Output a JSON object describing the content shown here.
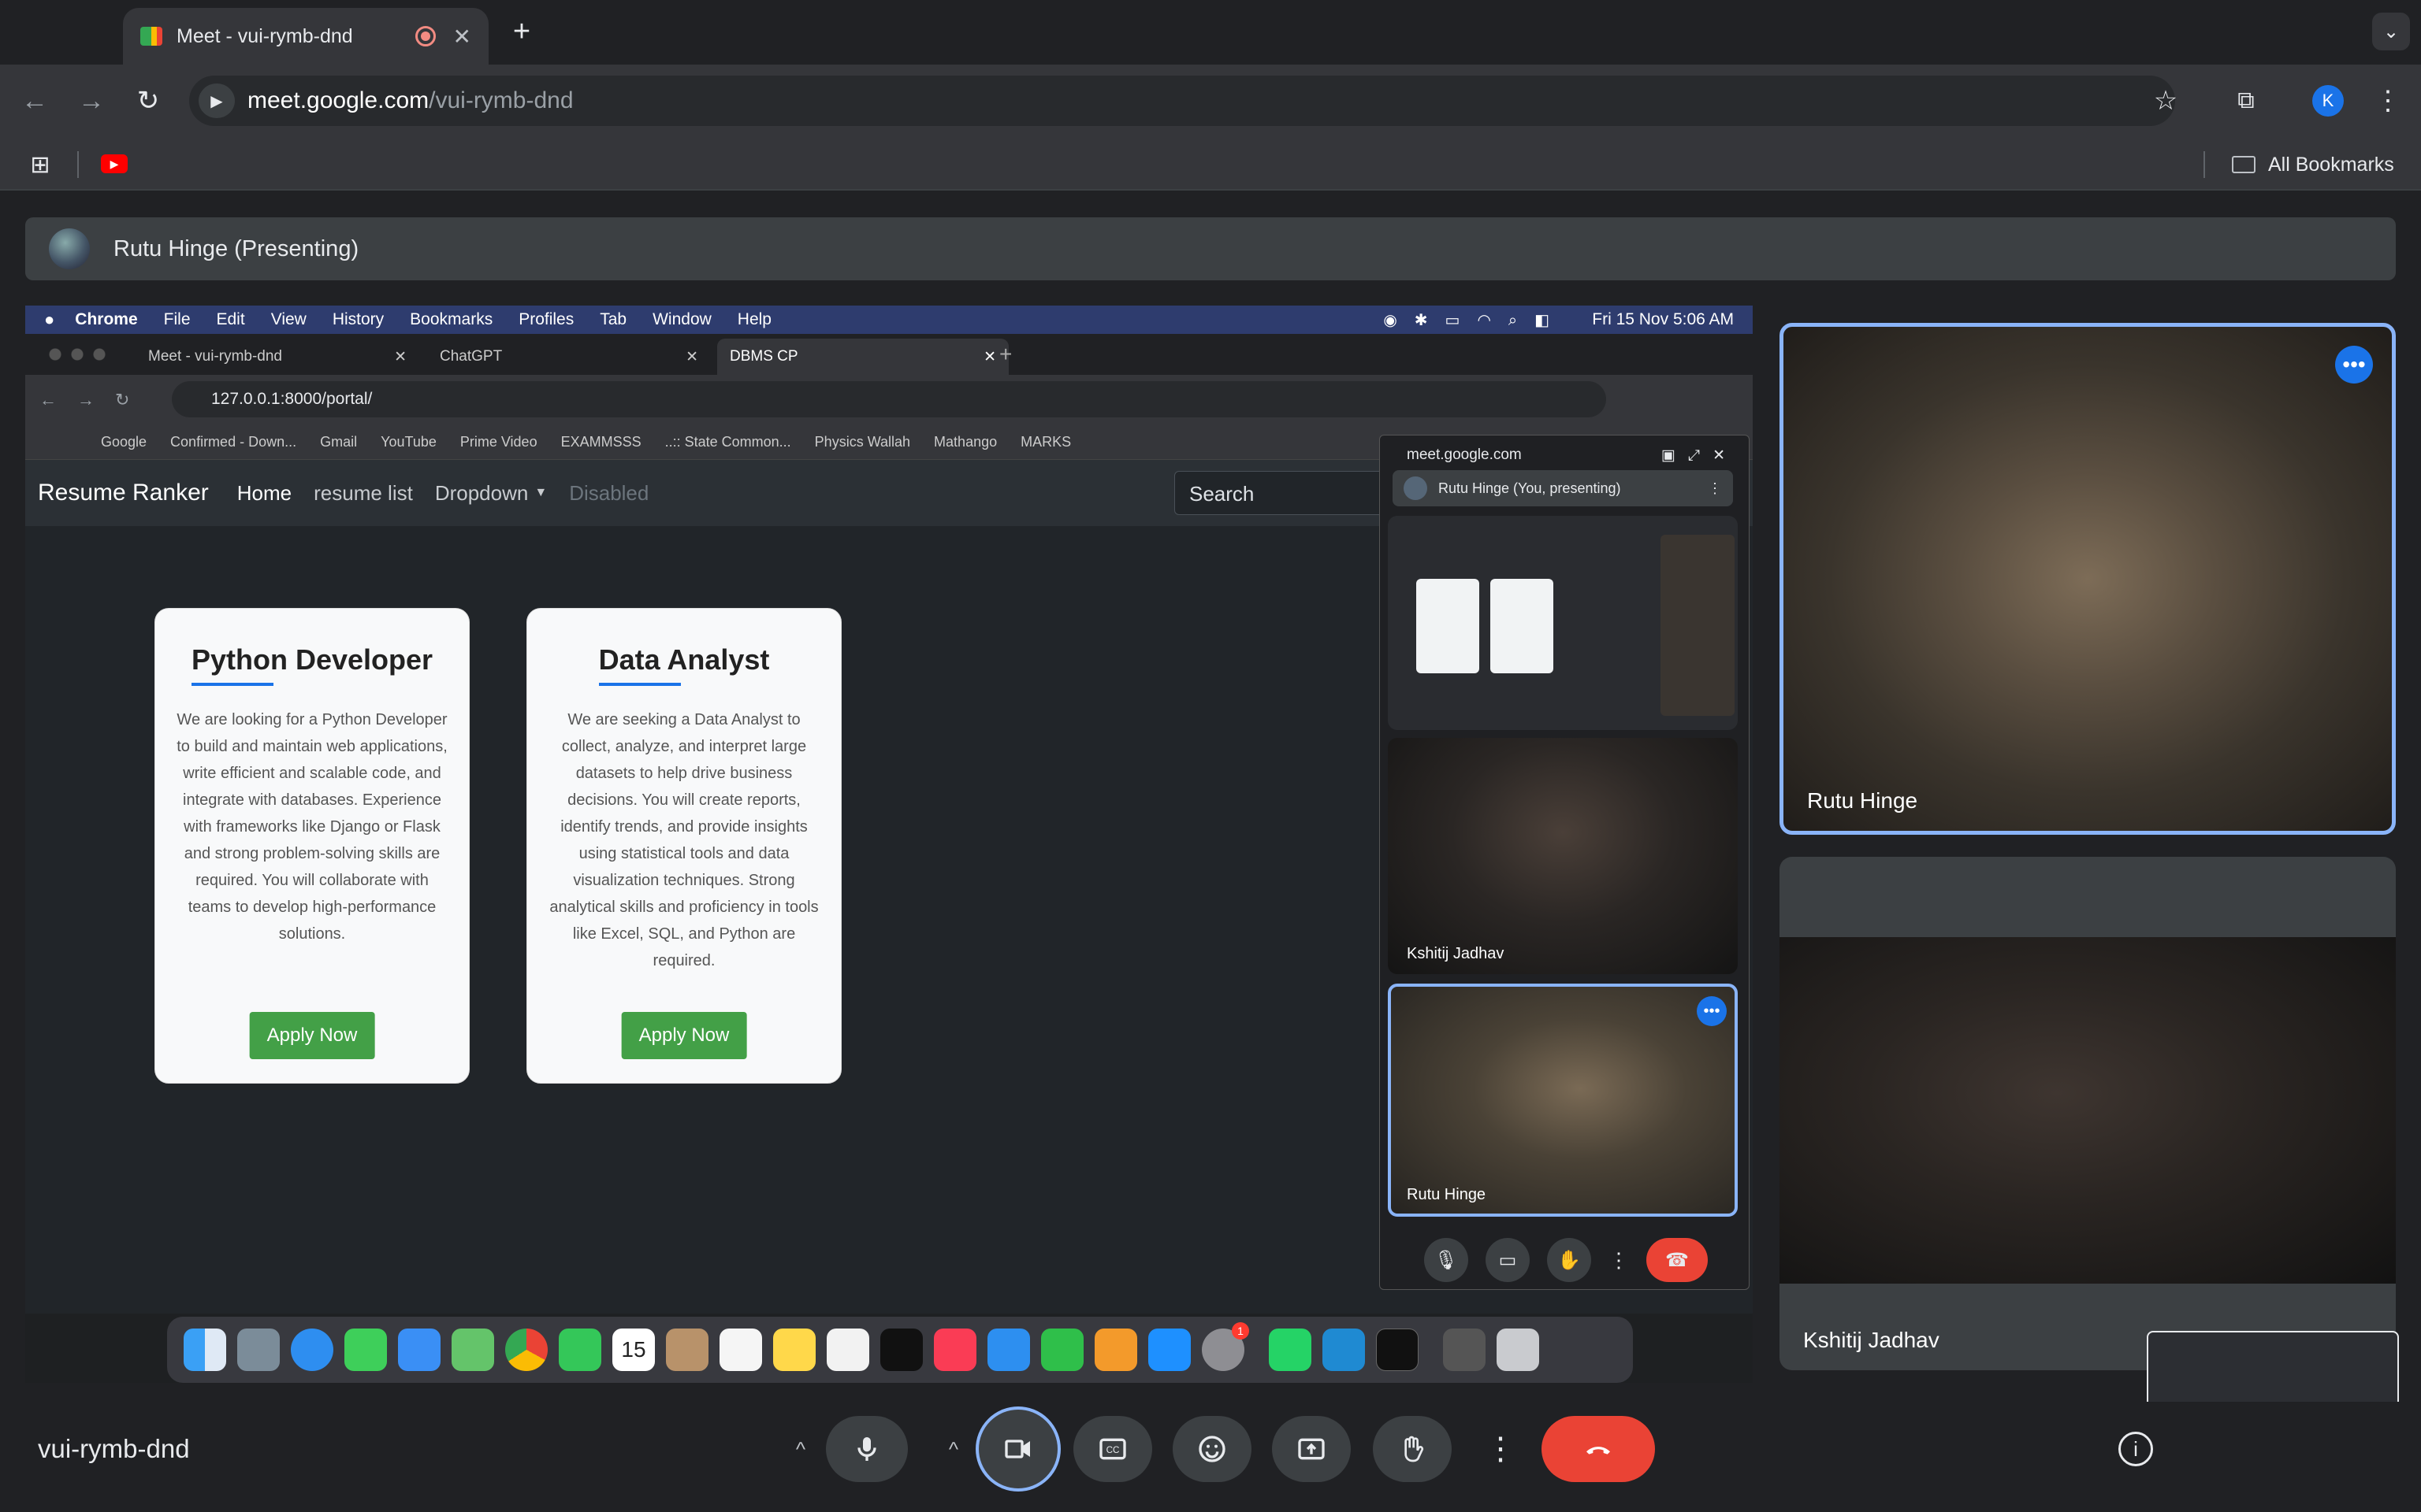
{
  "browser": {
    "tab_title": "Meet - vui-rymb-dnd",
    "url_domain": "meet.google.com",
    "url_path": "/vui-rymb-dnd",
    "profile_initial": "K",
    "all_bookmarks": "All Bookmarks"
  },
  "meet": {
    "presenter_label": "Rutu Hinge (Presenting)",
    "meeting_code": "vui-rymb-dnd",
    "participants": [
      "Rutu Hinge",
      "Kshitij Jadhav"
    ]
  },
  "shared_screen": {
    "mac_menu": [
      "Chrome",
      "File",
      "Edit",
      "View",
      "History",
      "Bookmarks",
      "Profiles",
      "Tab",
      "Window",
      "Help"
    ],
    "clock": "Fri 15 Nov  5:06 AM",
    "tabs": [
      "Meet - vui-rymb-dnd",
      "ChatGPT",
      "DBMS CP"
    ],
    "url": "127.0.0.1:8000/portal/",
    "bookmarks": [
      "Google",
      "Confirmed - Down...",
      "Gmail",
      "YouTube",
      "Prime Video",
      "EXAMMSSS",
      "..:: State Common...",
      "Physics Wallah",
      "Mathango",
      "MARKS"
    ],
    "site": {
      "brand": "Resume Ranker",
      "nav": [
        "Home",
        "resume list",
        "Dropdown",
        "Disabled"
      ],
      "search_placeholder": "Search",
      "cards": [
        {
          "title": "Python Developer",
          "description": "We are looking for a Python Developer to build and maintain web applications, write efficient and scalable code, and integrate with databases. Experience with frameworks like Django or Flask and strong problem-solving skills are required. You will collaborate with teams to develop high-performance solutions.",
          "button": "Apply Now"
        },
        {
          "title": "Data Analyst",
          "description": "We are seeking a Data Analyst to collect, analyze, and interpret large datasets to help drive business decisions. You will create reports, identify trends, and provide insights using statistical tools and data visualization techniques. Strong analytical skills and proficiency in tools like Excel, SQL, and Python are required.",
          "button": "Apply Now"
        }
      ]
    },
    "pip": {
      "domain": "meet.google.com",
      "presenting_label": "Rutu Hinge (You, presenting)",
      "tile_names": [
        "Kshitij Jadhav",
        "Rutu Hinge"
      ]
    },
    "dock_calendar_day": "15",
    "dock_badge": "1"
  },
  "colors": {
    "accent": "#1a73e8",
    "leave_red": "#ea4335",
    "apply_green": "#43a047"
  }
}
